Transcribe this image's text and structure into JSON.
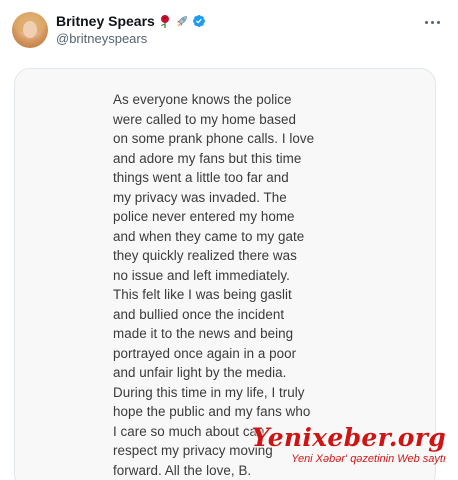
{
  "profile": {
    "display_name": "Britney Spears",
    "name_emojis": [
      "rose-emoji",
      "rocket-emoji"
    ],
    "handle": "@britneyspears",
    "verified": true
  },
  "post": {
    "statement_text": "As everyone knows the police\nwere called to my home based\non some prank phone calls. I love\nand adore my fans but this time\nthings went a little too far and\nmy privacy was invaded. The\npolice never entered my home\nand when they came to my gate\nthey quickly realized there was\nno issue and left immediately.\nThis felt like I was being gaslit\nand bullied once the incident\nmade it to the news and being\nportrayed once again in a poor\nand unfair light by the media.\nDuring this time in my life, I truly\nhope the public and my fans who\nI care so much about can\nrespect my privacy moving\nforward. All the love, B."
  },
  "watermark": {
    "title": "Yenixeber.org",
    "subtitle": "Yeni Xəbər' qəzetinin Web saytı"
  },
  "colors": {
    "name": "#0f1419",
    "handle": "#536471",
    "verified": "#1d9bf0",
    "statement_text": "#3a3a3a",
    "watermark": "#d01414"
  },
  "icons": {
    "more": "more-horizontal-icon",
    "verified": "verified-badge-icon"
  }
}
